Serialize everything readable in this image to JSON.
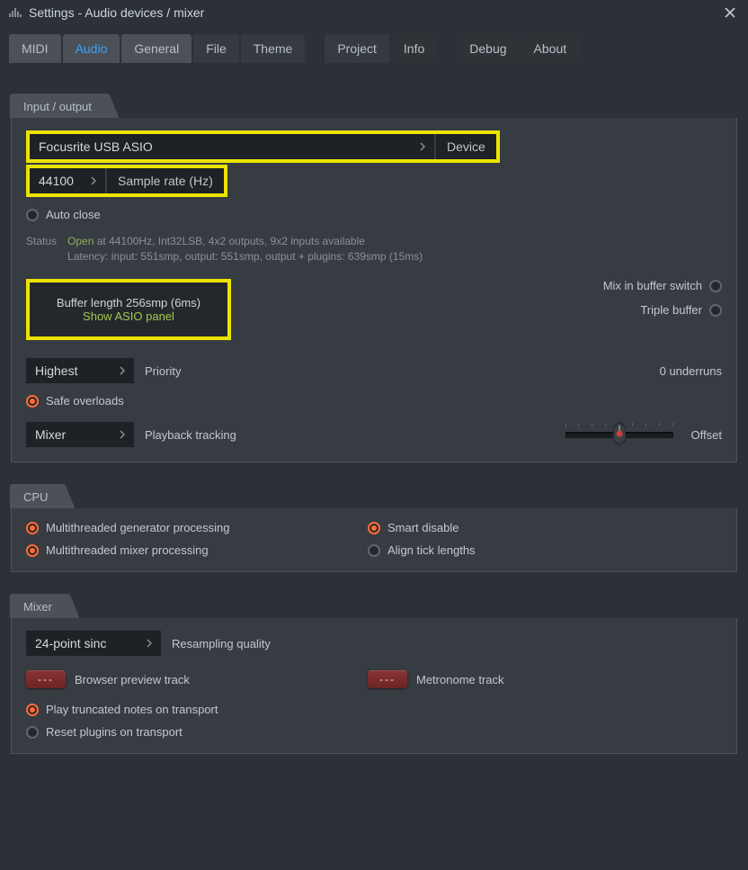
{
  "window": {
    "title": "Settings - Audio devices / mixer"
  },
  "tabs": {
    "midi": "MIDI",
    "audio": "Audio",
    "general": "General",
    "file": "File",
    "theme": "Theme",
    "project": "Project",
    "info": "Info",
    "debug": "Debug",
    "about": "About"
  },
  "io": {
    "heading": "Input / output",
    "device_value": "Focusrite USB ASIO",
    "device_label": "Device",
    "sample_rate_value": "44100",
    "sample_rate_label": "Sample rate (Hz)",
    "auto_close": "Auto close",
    "status_label": "Status",
    "status_open": "Open",
    "status_line1_rest": " at 44100Hz, Int32LSB, 4x2 outputs, 9x2 inputs available",
    "status_line2": "Latency: input: 551smp, output: 551smp, output + plugins: 639smp (15ms)",
    "buffer_length": "Buffer length 256smp (6ms)",
    "show_asio": "Show ASIO panel",
    "mix_in_buffer": "Mix in buffer switch",
    "triple_buffer": "Triple buffer",
    "priority_value": "Highest",
    "priority_label": "Priority",
    "underruns": "0 underruns",
    "safe_overloads": "Safe overloads",
    "playback_value": "Mixer",
    "playback_label": "Playback tracking",
    "offset_label": "Offset"
  },
  "cpu": {
    "heading": "CPU",
    "mt_generator": "Multithreaded generator processing",
    "mt_mixer": "Multithreaded mixer processing",
    "smart_disable": "Smart disable",
    "align_ticks": "Align tick lengths"
  },
  "mixer": {
    "heading": "Mixer",
    "resampling_value": "24-point sinc",
    "resampling_label": "Resampling quality",
    "browser_preview": "Browser preview track",
    "metronome": "Metronome track",
    "chip": "---",
    "play_truncated": "Play truncated notes on transport",
    "reset_plugins": "Reset plugins on transport"
  }
}
